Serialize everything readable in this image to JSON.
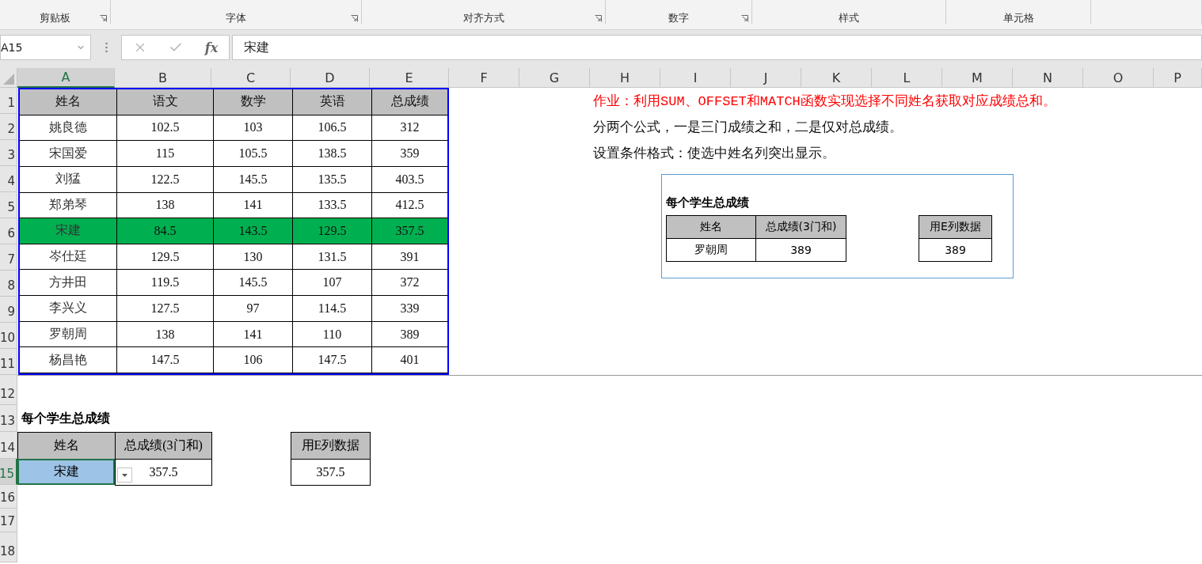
{
  "ribbon_groups": [
    {
      "label": "剪贴板",
      "launcher": true
    },
    {
      "label": "字体",
      "launcher": true
    },
    {
      "label": "对齐方式",
      "launcher": true
    },
    {
      "label": "数字",
      "launcher": true
    },
    {
      "label": "样式",
      "launcher": false
    },
    {
      "label": "单元格",
      "launcher": false
    }
  ],
  "formula_bar": {
    "name_box": "A15",
    "fx": "fx",
    "formula": "宋建"
  },
  "column_headers": [
    {
      "label": "A",
      "selected": true
    },
    {
      "label": "B",
      "selected": false
    },
    {
      "label": "C",
      "selected": false
    },
    {
      "label": "D",
      "selected": false
    },
    {
      "label": "E",
      "selected": false
    },
    {
      "label": "F",
      "selected": false
    },
    {
      "label": "G",
      "selected": false
    },
    {
      "label": "H",
      "selected": false
    },
    {
      "label": "I",
      "selected": false
    },
    {
      "label": "J",
      "selected": false
    },
    {
      "label": "K",
      "selected": false
    },
    {
      "label": "L",
      "selected": false
    },
    {
      "label": "M",
      "selected": false
    },
    {
      "label": "N",
      "selected": false
    },
    {
      "label": "O",
      "selected": false
    },
    {
      "label": "P",
      "selected": false
    }
  ],
  "row_headers": [
    {
      "label": "1",
      "selected": false
    },
    {
      "label": "2",
      "selected": false
    },
    {
      "label": "3",
      "selected": false
    },
    {
      "label": "4",
      "selected": false
    },
    {
      "label": "5",
      "selected": false
    },
    {
      "label": "6",
      "selected": false
    },
    {
      "label": "7",
      "selected": false
    },
    {
      "label": "8",
      "selected": false
    },
    {
      "label": "9",
      "selected": false
    },
    {
      "label": "10",
      "selected": false
    },
    {
      "label": "11",
      "selected": false
    },
    {
      "label": "12",
      "selected": false
    },
    {
      "label": "13",
      "selected": false
    },
    {
      "label": "14",
      "selected": false
    },
    {
      "label": "15",
      "selected": true
    },
    {
      "label": "16",
      "selected": false
    },
    {
      "label": "17",
      "selected": false
    },
    {
      "label": "18",
      "selected": false
    }
  ],
  "score_table": {
    "columns": [
      "姓名",
      "语文",
      "数学",
      "英语",
      "总成绩"
    ],
    "rows": [
      {
        "cells": [
          "姚良德",
          "102.5",
          "103",
          "106.5",
          "312"
        ],
        "highlighted": false
      },
      {
        "cells": [
          "宋国爱",
          "115",
          "105.5",
          "138.5",
          "359"
        ],
        "highlighted": false
      },
      {
        "cells": [
          "刘猛",
          "122.5",
          "145.5",
          "135.5",
          "403.5"
        ],
        "highlighted": false
      },
      {
        "cells": [
          "郑弟琴",
          "138",
          "141",
          "133.5",
          "412.5"
        ],
        "highlighted": false
      },
      {
        "cells": [
          "宋建",
          "84.5",
          "143.5",
          "129.5",
          "357.5"
        ],
        "highlighted": true
      },
      {
        "cells": [
          "岑仕廷",
          "129.5",
          "130",
          "131.5",
          "391"
        ],
        "highlighted": false
      },
      {
        "cells": [
          "方井田",
          "119.5",
          "145.5",
          "107",
          "372"
        ],
        "highlighted": false
      },
      {
        "cells": [
          "李兴义",
          "127.5",
          "97",
          "114.5",
          "339"
        ],
        "highlighted": false
      },
      {
        "cells": [
          "罗朝周",
          "138",
          "141",
          "110",
          "389"
        ],
        "highlighted": false
      },
      {
        "cells": [
          "杨昌艳",
          "147.5",
          "106",
          "147.5",
          "401"
        ],
        "highlighted": false
      }
    ]
  },
  "notes": [
    {
      "text": "作业：利用SUM、OFFSET和MATCH函数实现选择不同姓名获取对应成绩总和。",
      "kind": "task"
    },
    {
      "text": "分两个公式，一是三门成绩之和，二是仅对总成绩。",
      "kind": "plain"
    },
    {
      "text": "设置条件格式：使选中姓名列突出显示。",
      "kind": "plain"
    }
  ],
  "summary": {
    "title": "每个学生总成绩",
    "name_header": "姓名",
    "sum_header": "总成绩(3门和)",
    "e_header": "用E列数据",
    "name": "宋建",
    "sum": "357.5",
    "e_value": "357.5"
  },
  "range_picture": {
    "title": "每个学生总成绩",
    "name_header": "姓名",
    "sum_header": "总成绩(3门和)",
    "e_header": "用E列数据",
    "name": "罗朝周",
    "sum": "389",
    "e_value": "389"
  }
}
